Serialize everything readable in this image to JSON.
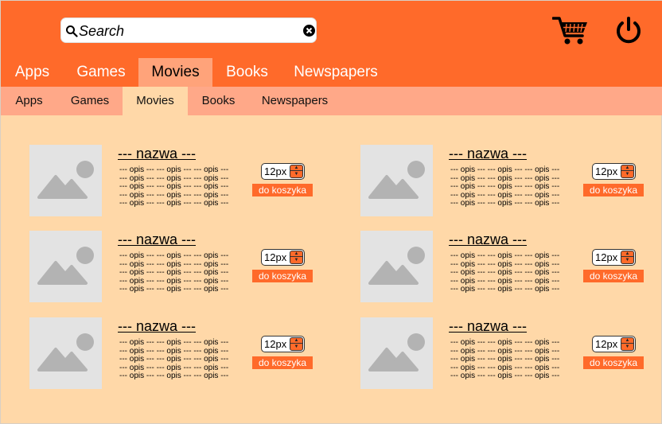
{
  "header": {
    "search": {
      "placeholder": "Search",
      "value": ""
    },
    "icons": {
      "search": "search-icon",
      "clear": "clear-icon",
      "cart": "cart-icon",
      "power": "power-icon"
    }
  },
  "nav_primary": {
    "tabs": [
      {
        "label": "Apps"
      },
      {
        "label": "Games"
      },
      {
        "label": "Movies",
        "active": true
      },
      {
        "label": "Books"
      },
      {
        "label": "Newspapers"
      }
    ]
  },
  "nav_secondary": {
    "tabs": [
      {
        "label": "Apps"
      },
      {
        "label": "Games"
      },
      {
        "label": "Movies",
        "active": true
      },
      {
        "label": "Books"
      },
      {
        "label": "Newspapers"
      }
    ]
  },
  "products": [
    {
      "name": "--- nazwa ---",
      "desc": [
        "--- opis --- --- opis --- --- opis ---",
        "--- opis --- --- opis --- --- opis ---",
        "--- opis --- --- opis --- --- opis ---",
        "--- opis --- --- opis --- --- opis ---",
        "--- opis --- --- opis --- --- opis ---"
      ],
      "qty": "12px",
      "add_label": "do koszyka"
    },
    {
      "name": "--- nazwa ---",
      "desc": [
        "--- opis --- --- opis --- --- opis ---",
        "--- opis --- --- opis --- --- opis ---",
        "--- opis --- --- opis --- --- opis ---",
        "--- opis --- --- opis --- --- opis ---",
        "--- opis --- --- opis --- --- opis ---"
      ],
      "qty": "12px",
      "add_label": "do koszyka"
    },
    {
      "name": "--- nazwa ---",
      "desc": [
        "--- opis --- --- opis --- --- opis ---",
        "--- opis --- --- opis --- --- opis ---",
        "--- opis --- --- opis --- --- opis ---",
        "--- opis --- --- opis --- --- opis ---",
        "--- opis --- --- opis --- --- opis ---"
      ],
      "qty": "12px",
      "add_label": "do koszyka"
    },
    {
      "name": "--- nazwa ---",
      "desc": [
        "--- opis --- --- opis --- --- opis ---",
        "--- opis --- --- opis --- --- opis ---",
        "--- opis --- --- opis --- --- opis ---",
        "--- opis --- --- opis --- --- opis ---",
        "--- opis --- --- opis --- --- opis ---"
      ],
      "qty": "12px",
      "add_label": "do koszyka"
    },
    {
      "name": "--- nazwa ---",
      "desc": [
        "--- opis --- --- opis --- --- opis ---",
        "--- opis --- --- opis --- --- opis ---",
        "--- opis --- --- opis --- --- opis ---",
        "--- opis --- --- opis --- --- opis ---",
        "--- opis --- --- opis --- --- opis ---"
      ],
      "qty": "12px",
      "add_label": "do koszyka"
    },
    {
      "name": "--- nazwa ---",
      "desc": [
        "--- opis --- --- opis --- --- opis ---",
        "--- opis --- --- opis --- --- opis ---",
        "--- opis --- --- opis --- --- opis ---",
        "--- opis --- --- opis --- --- opis ---",
        "--- opis --- --- opis --- --- opis ---"
      ],
      "qty": "12px",
      "add_label": "do koszyka"
    }
  ],
  "colors": {
    "accent": "#ff6a2a",
    "secondary_nav": "#ffa888",
    "content_bg": "#ffd8a8",
    "thumb_bg": "#e3e3e3",
    "thumb_icon": "#b3b3b3"
  }
}
